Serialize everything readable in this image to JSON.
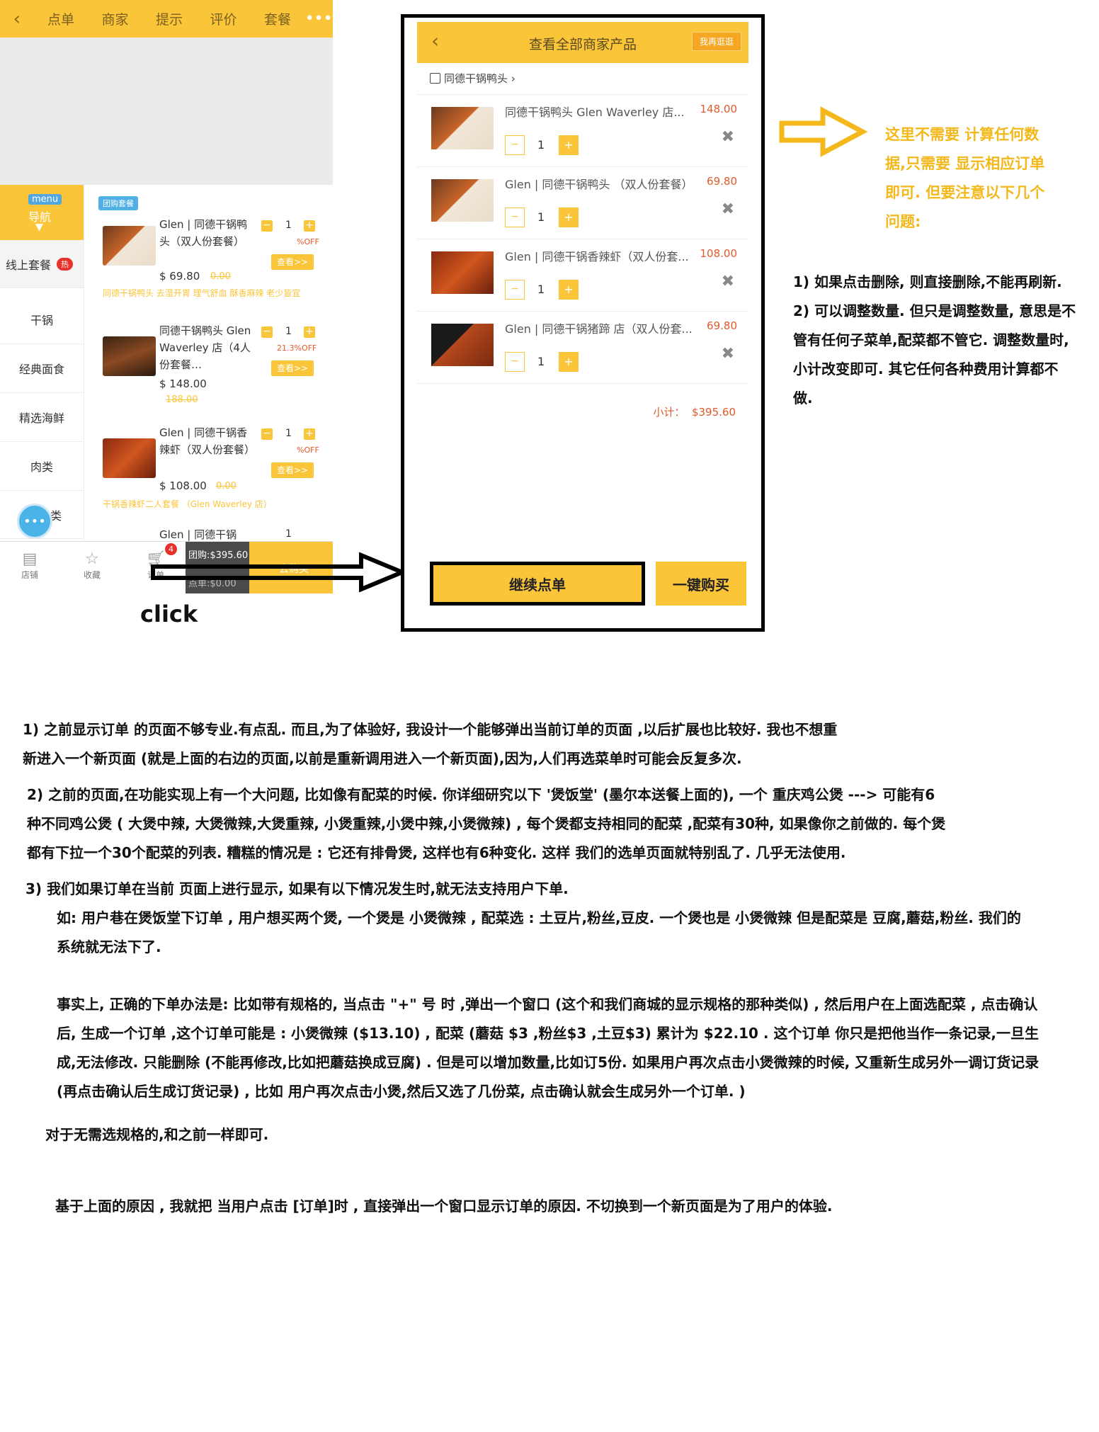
{
  "left_screen": {
    "top_nav": {
      "back": "‹",
      "tabs": [
        "点单",
        "商家",
        "提示",
        "评价",
        "套餐"
      ],
      "more": "•••"
    },
    "side_nav": {
      "menu_label": "menu",
      "nav_label": "导航",
      "items": [
        "线上套餐",
        "干锅",
        "经典面食",
        "精选海鲜",
        "肉类",
        "类"
      ],
      "hot_badge": "热"
    },
    "group_tag": "团购套餐",
    "products": [
      {
        "name": "Glen | 同德干锅鸭头（双人份套餐）",
        "price": "$ 69.80",
        "old_price": "0.00",
        "qty": "1",
        "off": "%OFF",
        "view": "查看>>",
        "desc": "同德干锅鸭头 去湿开胃 理气舒血 酥香麻辣 老少皆宜"
      },
      {
        "name": "同德干锅鸭头 Glen Waverley 店（4人份套餐…",
        "price": "$ 148.00",
        "old_price": "188.00",
        "qty": "1",
        "off": "21.3%OFF",
        "view": "查看>>",
        "desc": ""
      },
      {
        "name": "Glen | 同德干锅香辣虾（双人份套餐）",
        "price": "$ 108.00",
        "old_price": "0.00",
        "qty": "1",
        "off": "%OFF",
        "view": "查看>>",
        "desc": "干锅香辣虾二人套餐 （Glen Waverley 店）"
      },
      {
        "name": "Glen | 同德干锅",
        "price": "",
        "old_price": "",
        "qty": "1",
        "off": "",
        "view": "",
        "desc": ""
      }
    ],
    "bottom_bar": {
      "store": "店铺",
      "favorite": "收藏",
      "order": "订单",
      "cart_count": "4",
      "group_total": "团购:$395.60",
      "dian_total": "点单:$0.00",
      "buy": "去购买"
    },
    "click_label": "click"
  },
  "popup": {
    "title": "查看全部商家产品",
    "shop_button": "我再逛逛",
    "merchant": "同德干锅鸭头",
    "orders": [
      {
        "name": "同德干锅鸭头 Glen Waverley 店...",
        "price": "148.00",
        "qty": "1"
      },
      {
        "name": "Glen | 同德干锅鸭头 （双人份套餐）",
        "price": "69.80",
        "qty": "1"
      },
      {
        "name": "Glen | 同德干锅香辣虾（双人份套...",
        "price": "108.00",
        "qty": "1"
      },
      {
        "name": "Glen | 同德干锅猪蹄 店（双人份套...",
        "price": "69.80",
        "qty": "1"
      }
    ],
    "subtotal_label": "小计：",
    "subtotal_value": "$395.60",
    "continue": "继续点单",
    "one_click": "一键购买"
  },
  "annotations": {
    "yellow_note": "这里不需要 计算任何数据,只需要 显示相应订单即可. 但要注意以下几个问题:",
    "popup_notes": [
      "1) 如果点击删除, 则直接删除,不能再刷新.",
      "2) 可以调整数量. 但只是调整数量, 意思是不管有任何子菜单,配菜都不管它. 调整数量时,小计改变即可. 其它任何各种费用计算都不做."
    ],
    "main_notes": [
      "1) 之前显示订单 的页面不够专业.有点乱. 而且,为了体验好, 我设计一个能够弹出当前订单的页面 ,以后扩展也比较好. 我也不想重新进入一个新页面 (就是上面的右边的页面,以前是重新调用进入一个新页面),因为,人们再选菜单时可能会反复多次.",
      "2) 之前的页面,在功能实现上有一个大问题, 比如像有配菜的时候. 你详细研究以下 '煲饭堂' (墨尔本送餐上面的), 一个 重庆鸡公煲 ---> 可能有6种不同鸡公煲 ( 大煲中辣, 大煲微辣,大煲重辣, 小煲重辣,小煲中辣,小煲微辣) , 每个煲都支持相同的配菜 ,配菜有30种, 如果像你之前做的. 每个煲 都有下拉一个30个配菜的列表. 糟糕的情况是 : 它还有排骨煲, 这样也有6种变化. 这样 我们的选单页面就特别乱了. 几乎无法使用.",
      "3) 我们如果订单在当前 页面上进行显示, 如果有以下情况发生时,就无法支持用户下单.",
      "如: 用户巷在煲饭堂下订单 , 用户想买两个煲, 一个煲是 小煲微辣 , 配菜选 : 土豆片,粉丝,豆皮.  一个煲也是 小煲微辣 但是配菜是 豆腐,蘑菇,粉丝.  我们的系统就无法下了.",
      "事实上, 正确的下单办法是:  比如带有规格的, 当点击 \"+\" 号 时 ,弹出一个窗口 (这个和我们商城的显示规格的那种类似) , 然后用户在上面选配菜 , 点击确认后, 生成一个订单 ,这个订单可能是 : 小煲微辣 ($13.10) , 配菜 (蘑菇 $3 ,粉丝$3 ,土豆$3) 累计为 $22.10 .  这个订单 你只是把他当作一条记录,一旦生成,无法修改. 只能删除 (不能再修改,比如把蘑菇换成豆腐) . 但是可以增加数量,比如订5份. 如果用户再次点击小煲微辣的时候, 又重新生成另外一调订货记录 (再点击确认后生成订货记录) , 比如 用户再次点击小煲,然后又选了几份菜, 点击确认就会生成另外一个订单. )",
      "对于无需选规格的,和之前一样即可.",
      "基于上面的原因 , 我就把 当用户点击 [订单]时 , 直接弹出一个窗口显示订单的原因. 不切换到一个新页面是为了用户的体验."
    ]
  },
  "colors": {
    "brand_yellow": "#fbc53a",
    "price_red": "#e05a2a",
    "hot_red": "#e8312a",
    "note_yellow": "#f3b81c"
  }
}
